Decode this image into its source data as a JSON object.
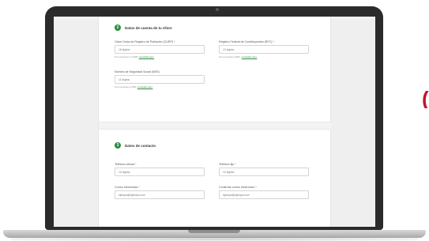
{
  "section1": {
    "number": "2",
    "title": "Datos de cuenta de tu Afore",
    "curp": {
      "label": "Clave Única de Registro de Población (CURP)",
      "required": "*",
      "placeholder": "18 dígitos",
      "hint": "Si no conoces tu CURP, ",
      "hint_link": "consúltala aquí."
    },
    "rfc": {
      "label": "Registro Federal de Contribuyentes (RFC)",
      "required": "*",
      "placeholder": "13 dígitos",
      "hint": "Si no conoces tu RFC, ",
      "hint_link": "consúltalo aquí."
    },
    "nss": {
      "label": "Número de Seguridad Social (NSS)",
      "placeholder": "11 dígitos",
      "hint": "Si no conoces tu NSS, ",
      "hint_link": "consúltalo aquí."
    }
  },
  "section2": {
    "number": "3",
    "title": "Datos de contacto",
    "mobile": {
      "label": "Teléfono celular",
      "required": "*",
      "placeholder": "10 dígitos"
    },
    "landline": {
      "label": "Teléfono fijo",
      "required": "*",
      "placeholder": "10 dígitos"
    },
    "email": {
      "label": "Correo electrónico",
      "required": "*",
      "placeholder": "ejemplo@ejemplo.com"
    },
    "email_confirm": {
      "label": "Confirmar correo electrónico",
      "required": "*",
      "placeholder": "ejemplo@ejemplo.com"
    }
  },
  "colors": {
    "accent": "#2e8b3e",
    "required": "#d33333",
    "brand_partial": "#c8102e"
  },
  "logo_fragment": "("
}
